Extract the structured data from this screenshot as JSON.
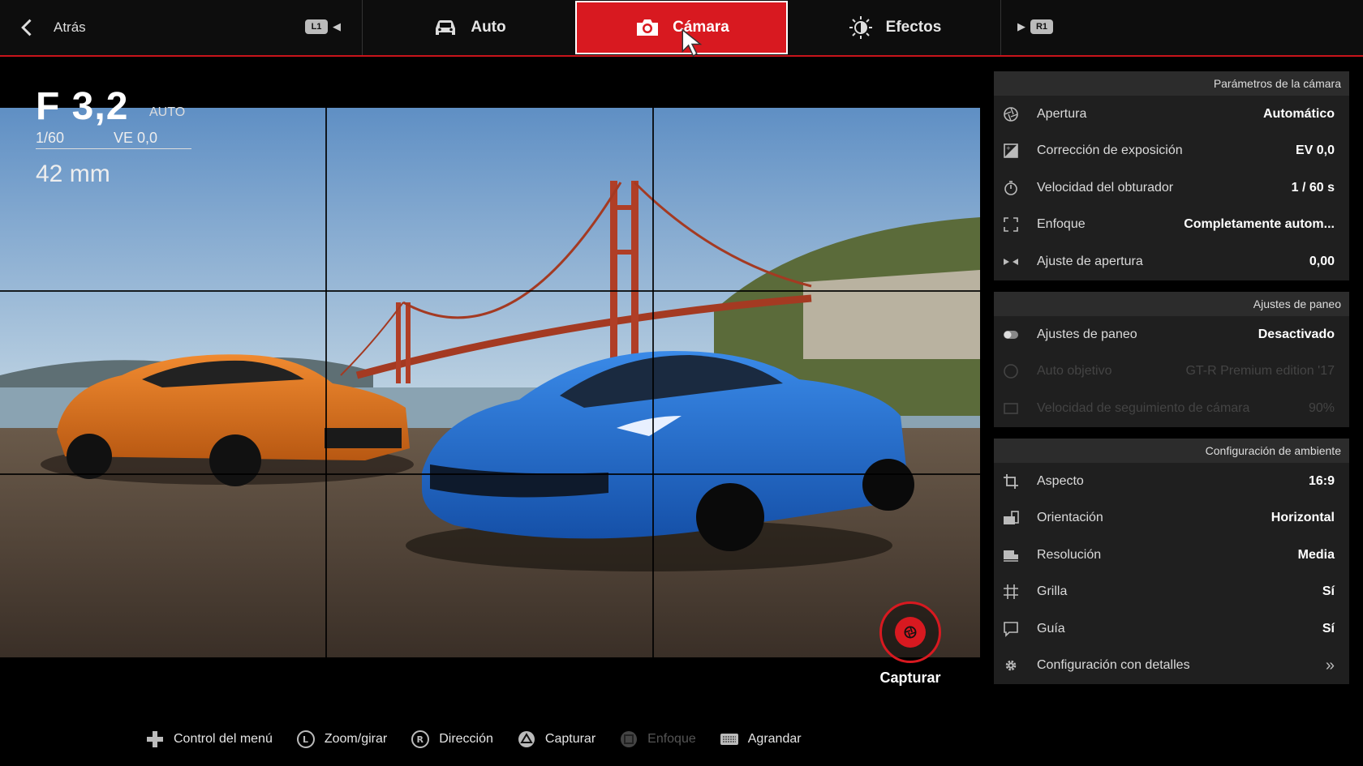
{
  "topbar": {
    "back_label": "Atrás",
    "left_hint": "L1",
    "right_hint": "R1",
    "tabs": [
      {
        "label": "Auto",
        "icon": "car-icon"
      },
      {
        "label": "Cámara",
        "icon": "camera-icon",
        "active": true
      },
      {
        "label": "Efectos",
        "icon": "brightness-icon"
      }
    ]
  },
  "viewfinder": {
    "aperture": "F 3,2",
    "aperture_mode": "AUTO",
    "shutter": "1/60",
    "ev": "VE 0,0",
    "focal_length": "42 mm",
    "capture_label": "Capturar"
  },
  "panels": {
    "camera": {
      "title": "Parámetros de la cámara",
      "rows": [
        {
          "label": "Apertura",
          "value": "Automático",
          "icon": "aperture-icon"
        },
        {
          "label": "Corrección de exposición",
          "value": "EV 0,0",
          "icon": "exposure-icon"
        },
        {
          "label": "Velocidad del obturador",
          "value": "1 / 60 s",
          "icon": "stopwatch-icon"
        },
        {
          "label": "Enfoque",
          "value": "Completamente autom...",
          "icon": "focus-icon"
        },
        {
          "label": "Ajuste de apertura",
          "value": "0,00",
          "icon": "aperture-adjust-icon"
        }
      ]
    },
    "panning": {
      "title": "Ajustes de paneo",
      "rows": [
        {
          "label": "Ajustes de paneo",
          "value": "Desactivado",
          "icon": "toggle-icon"
        },
        {
          "label": "Auto objetivo",
          "value": "GT-R Premium edition '17",
          "icon": "target-icon"
        },
        {
          "label": "Velocidad de seguimiento de cámara",
          "value": "90%",
          "icon": "speed-icon"
        }
      ]
    },
    "environment": {
      "title": "Configuración de ambiente",
      "rows": [
        {
          "label": "Aspecto",
          "value": "16:9",
          "icon": "crop-icon"
        },
        {
          "label": "Orientación",
          "value": "Horizontal",
          "icon": "orientation-icon"
        },
        {
          "label": "Resolución",
          "value": "Media",
          "icon": "resolution-icon"
        },
        {
          "label": "Grilla",
          "value": "Sí",
          "icon": "grid-icon"
        },
        {
          "label": "Guía",
          "value": "Sí",
          "icon": "guide-icon"
        },
        {
          "label": "Configuración con detalles",
          "value": "",
          "icon": "gear-icon"
        }
      ]
    }
  },
  "bottom_hints": [
    {
      "label": "Control del menú",
      "icon": "dpad-icon"
    },
    {
      "label": "Zoom/girar",
      "icon": "left-stick-icon"
    },
    {
      "label": "Dirección",
      "icon": "right-stick-icon"
    },
    {
      "label": "Capturar",
      "icon": "triangle-button-icon"
    },
    {
      "label": "Enfoque",
      "icon": "square-button-icon"
    },
    {
      "label": "Agrandar",
      "icon": "touchpad-icon"
    }
  ],
  "colors": {
    "accent": "#d81920",
    "panel_bg": "#1f1f1f",
    "orange_car": "#e0701f",
    "blue_car": "#1f6fd0"
  }
}
